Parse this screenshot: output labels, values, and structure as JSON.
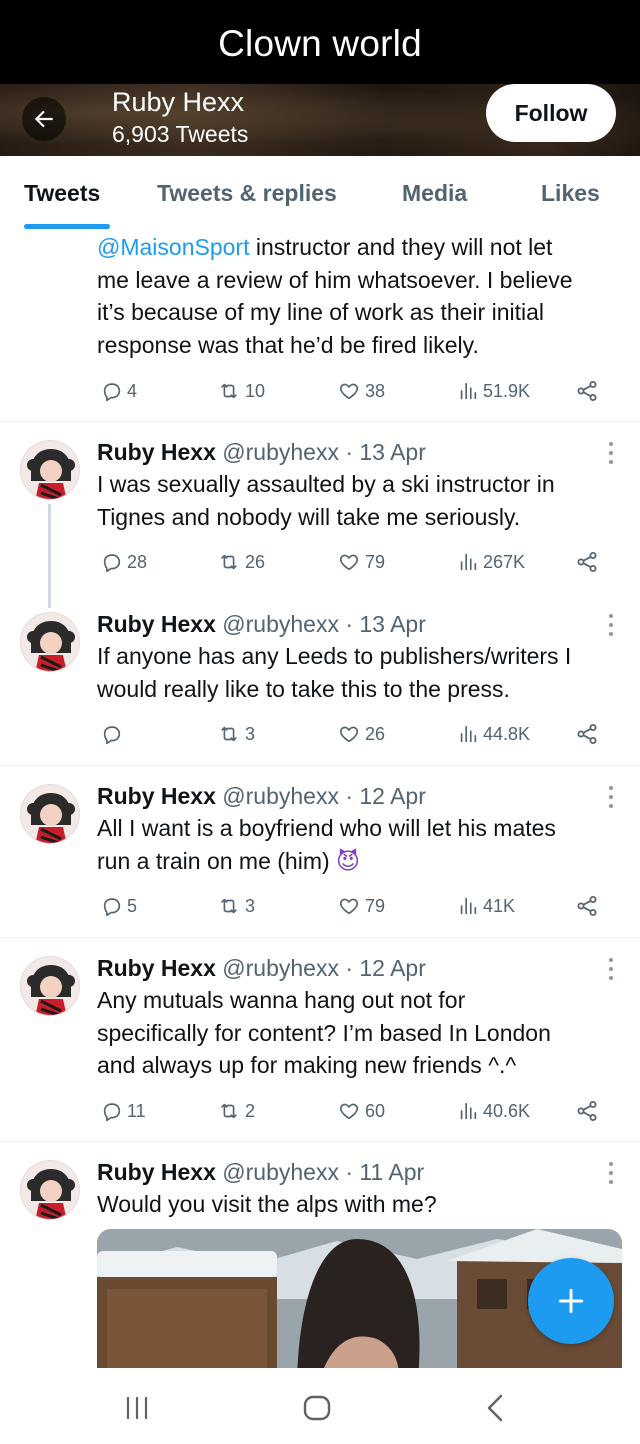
{
  "caption": "Clown world",
  "profile": {
    "name": "Ruby Hexx",
    "tweet_count": "6,903 Tweets",
    "follow_label": "Follow"
  },
  "tabs": [
    "Tweets",
    "Tweets & replies",
    "Media",
    "Likes"
  ],
  "active_tab": "Tweets",
  "colors": {
    "accent": "#1d9bf0",
    "text": "#0f1419",
    "muted": "#536471"
  },
  "partial_tweet": {
    "mention": "@MaisonSport",
    "line1_rest": " instructor and they will not let",
    "line2": "me leave a review of him whatsoever. I believe",
    "line3": "it’s because of my line of work as their initial",
    "line4": "response was that he’d be fired likely.",
    "replies": "4",
    "retweets": "10",
    "likes": "38",
    "views": "51.9K"
  },
  "tweets": [
    {
      "name": "Ruby Hexx",
      "handle": "@rubyhexx · 13 Apr",
      "lines": [
        "I was sexually assaulted by a ski instructor in",
        "Tignes and nobody will take me seriously."
      ],
      "replies": "28",
      "retweets": "26",
      "likes": "79",
      "views": "267K"
    },
    {
      "name": "Ruby Hexx",
      "handle": "@rubyhexx · 13 Apr",
      "lines": [
        "If anyone has any Leeds to publishers/writers I",
        "would really like to take this to the press."
      ],
      "replies": "",
      "retweets": "3",
      "likes": "26",
      "views": "44.8K"
    },
    {
      "name": "Ruby Hexx",
      "handle": "@rubyhexx · 12 Apr",
      "lines": [
        "All I want is a boyfriend who will let his mates",
        "run a train on me (him)"
      ],
      "emoji": "😈",
      "replies": "5",
      "retweets": "3",
      "likes": "79",
      "views": "41K"
    },
    {
      "name": "Ruby Hexx",
      "handle": "@rubyhexx · 12 Apr",
      "lines": [
        "Any mutuals wanna hang out not for",
        "specifically for content? I’m based In London",
        "and always up for making new friends ^.^"
      ],
      "replies": "11",
      "retweets": "2",
      "likes": "60",
      "views": "40.6K"
    },
    {
      "name": "Ruby Hexx",
      "handle": "@rubyhexx · 11 Apr",
      "lines": [
        "Would you visit the alps with me?"
      ]
    }
  ],
  "icons": {
    "back": "arrow-left-icon",
    "reply": "reply-icon",
    "retweet": "retweet-icon",
    "like": "heart-icon",
    "views": "views-chart-icon",
    "share": "share-icon",
    "more": "more-vertical-icon",
    "compose": "plus-icon",
    "nav": [
      "recent-apps-icon",
      "home-icon",
      "back-chevron-icon"
    ]
  }
}
